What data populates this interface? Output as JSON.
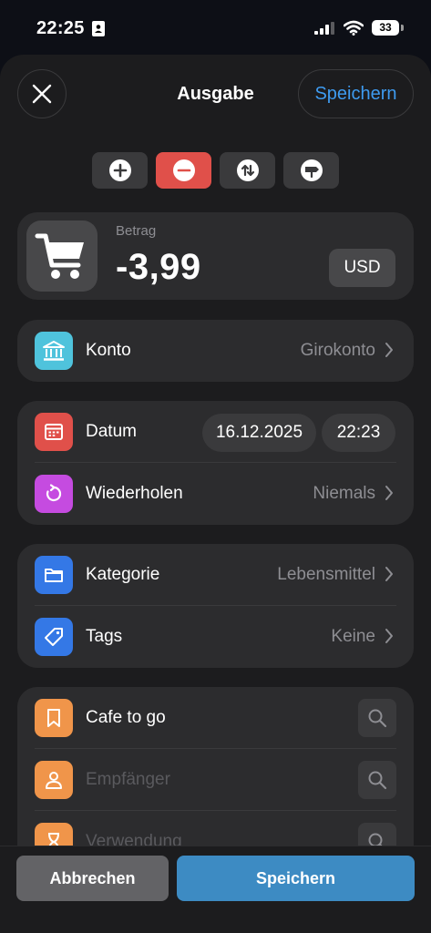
{
  "status_bar": {
    "time": "22:25",
    "battery": "33"
  },
  "header": {
    "title": "Ausgabe",
    "save_label": "Speichern"
  },
  "type_buttons": [
    {
      "name": "income",
      "active": false
    },
    {
      "name": "expense",
      "active": true
    },
    {
      "name": "transfer",
      "active": false
    },
    {
      "name": "adjustment",
      "active": false
    }
  ],
  "amount": {
    "label": "Betrag",
    "value": "-3,99",
    "currency": "USD"
  },
  "account": {
    "label": "Konto",
    "value": "Girokonto"
  },
  "date": {
    "label": "Datum",
    "date": "16.12.2025",
    "time": "22:23"
  },
  "repeat": {
    "label": "Wiederholen",
    "value": "Niemals"
  },
  "category": {
    "label": "Kategorie",
    "value": "Lebensmittel"
  },
  "tags": {
    "label": "Tags",
    "value": "Keine"
  },
  "details": {
    "title": "Cafe to go",
    "payee_placeholder": "Empfänger",
    "purpose_placeholder": "Verwendung"
  },
  "footer": {
    "cancel_label": "Abbrechen",
    "save_label": "Speichern"
  },
  "colors": {
    "accent": "#3e9bf0",
    "expense_active": "#e0504a",
    "account_icon": "#4fc3dc",
    "date_icon": "#e0504a",
    "repeat_icon": "#c54be0",
    "category_icon": "#3478e6",
    "tags_icon": "#3478e6",
    "details_icon": "#f0954a",
    "save_button": "#3d8bc3"
  }
}
